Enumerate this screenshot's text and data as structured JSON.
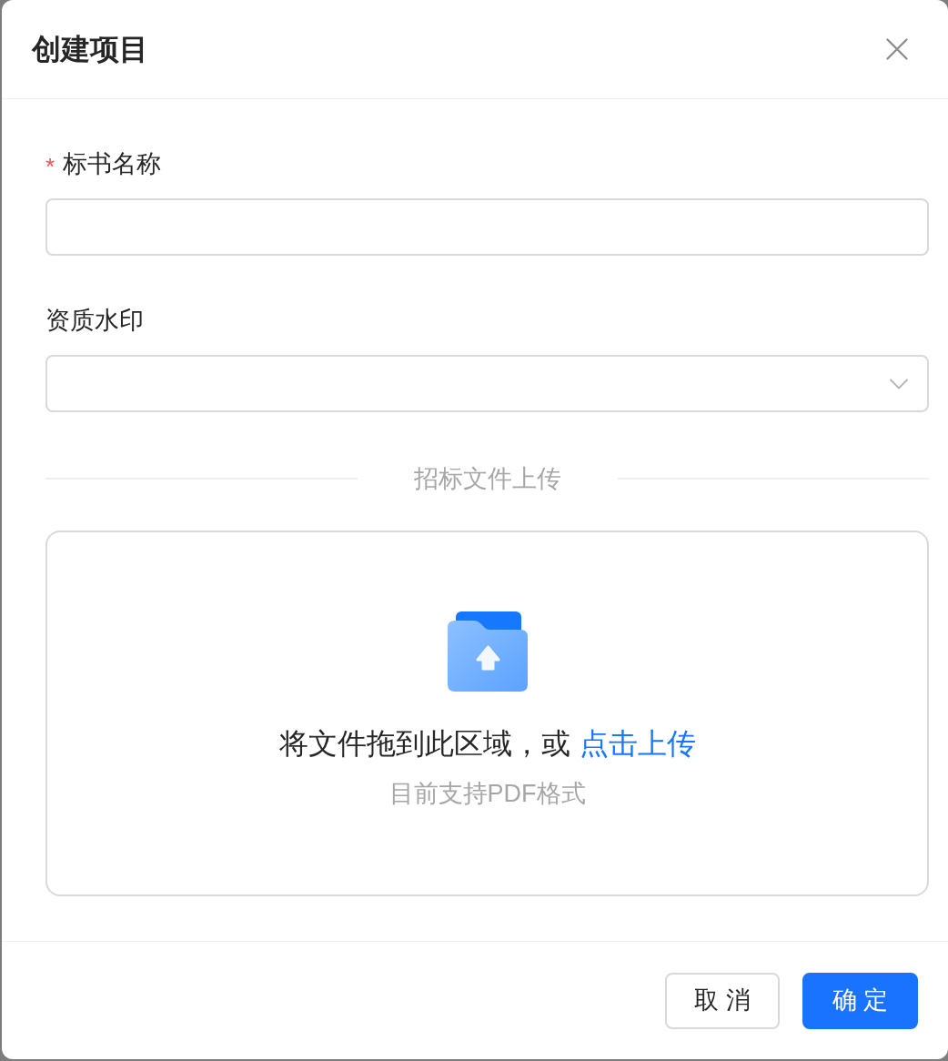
{
  "dialog": {
    "title": "创建项目",
    "closable": true
  },
  "fields": [
    {
      "kind": "text",
      "label": "标书名称",
      "required_mark": "*"
    },
    {
      "kind": "select",
      "label": "资质水印"
    }
  ],
  "divider": {
    "label": "招标文件上传"
  },
  "upload": {
    "prompt": "将文件拖到此区域，或",
    "link": "点击上传",
    "hint": "目前支持PDF格式"
  },
  "buttons": [
    {
      "kind": "default",
      "label": "取 消"
    },
    {
      "kind": "primary",
      "label": "确 定"
    }
  ]
}
